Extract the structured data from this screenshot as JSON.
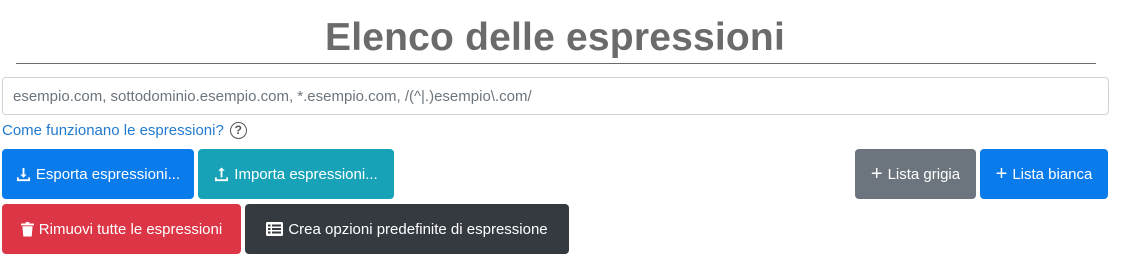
{
  "header": {
    "title": "Elenco delle espressioni"
  },
  "expression_input": {
    "value": "",
    "placeholder": "esempio.com, sottodominio.esempio.com, *.esempio.com, /(^|.)esempio\\.com/"
  },
  "help": {
    "link_text": "Come funzionano le espressioni?",
    "icon": "question-circle-icon"
  },
  "toolbar": {
    "export_label": "Esporta espressioni...",
    "import_label": "Importa espressioni...",
    "greylist_label": "Lista grigia",
    "whitelist_label": "Lista bianca",
    "remove_all_label": "Rimuovi tutte le espressioni",
    "create_defaults_label": "Crea opzioni predefinite di espressione"
  },
  "colors": {
    "primary": "#0a7bea",
    "info": "#17a2b8",
    "secondary": "#6c757d",
    "danger": "#dc3545",
    "dark": "#343a40",
    "title": "#6b6b6b",
    "link": "#1f7ad0"
  }
}
